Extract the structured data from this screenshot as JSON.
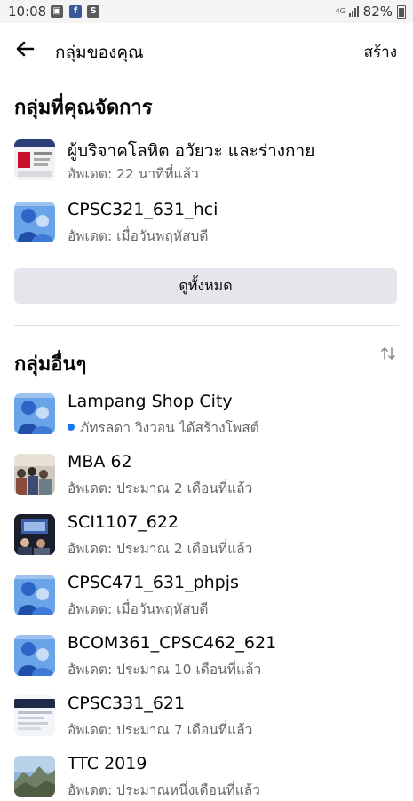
{
  "status": {
    "time": "10:08",
    "network": "4G",
    "battery": "82%"
  },
  "header": {
    "title": "กลุ่มของคุณ",
    "create": "สร้าง"
  },
  "managed": {
    "title": "กลุ่มที่คุณจัดการ",
    "items": [
      {
        "name": "ผู้บริจาคโลหิต อวัยวะ และร่างกาย",
        "sub": "อัพเดต: 22 นาทีที่แล้ว"
      },
      {
        "name": "CPSC321_631_hci",
        "sub": "อัพเดต: เมื่อวันพฤหัสบดี"
      }
    ],
    "see_all": "ดูทั้งหมด"
  },
  "other": {
    "title": "กลุ่มอื่นๆ",
    "items": [
      {
        "name": "Lampang Shop City",
        "sub": "ภัทรลดา วิงวอน ได้สร้างโพสต์"
      },
      {
        "name": "MBA 62",
        "sub": "อัพเดต: ประมาณ 2 เดือนที่แล้ว"
      },
      {
        "name": "SCI1107_622",
        "sub": "อัพเดต: ประมาณ 2 เดือนที่แล้ว"
      },
      {
        "name": "CPSC471_631_phpjs",
        "sub": "อัพเดต: เมื่อวันพฤหัสบดี"
      },
      {
        "name": "BCOM361_CPSC462_621",
        "sub": "อัพเดต: ประมาณ 10 เดือนที่แล้ว"
      },
      {
        "name": "CPSC331_621",
        "sub": "อัพเดต: ประมาณ 7 เดือนที่แล้ว"
      },
      {
        "name": "TTC 2019",
        "sub": "อัพเดต: ประมาณหนึ่งเดือนที่แล้ว"
      }
    ]
  },
  "colors": {
    "accent": "#1877f2",
    "secondary_text": "#65676b",
    "button_bg": "#e4e6eb"
  },
  "icons": {
    "back": "arrow-left",
    "sort": "sort-arrows",
    "unread": "blue-dot"
  }
}
